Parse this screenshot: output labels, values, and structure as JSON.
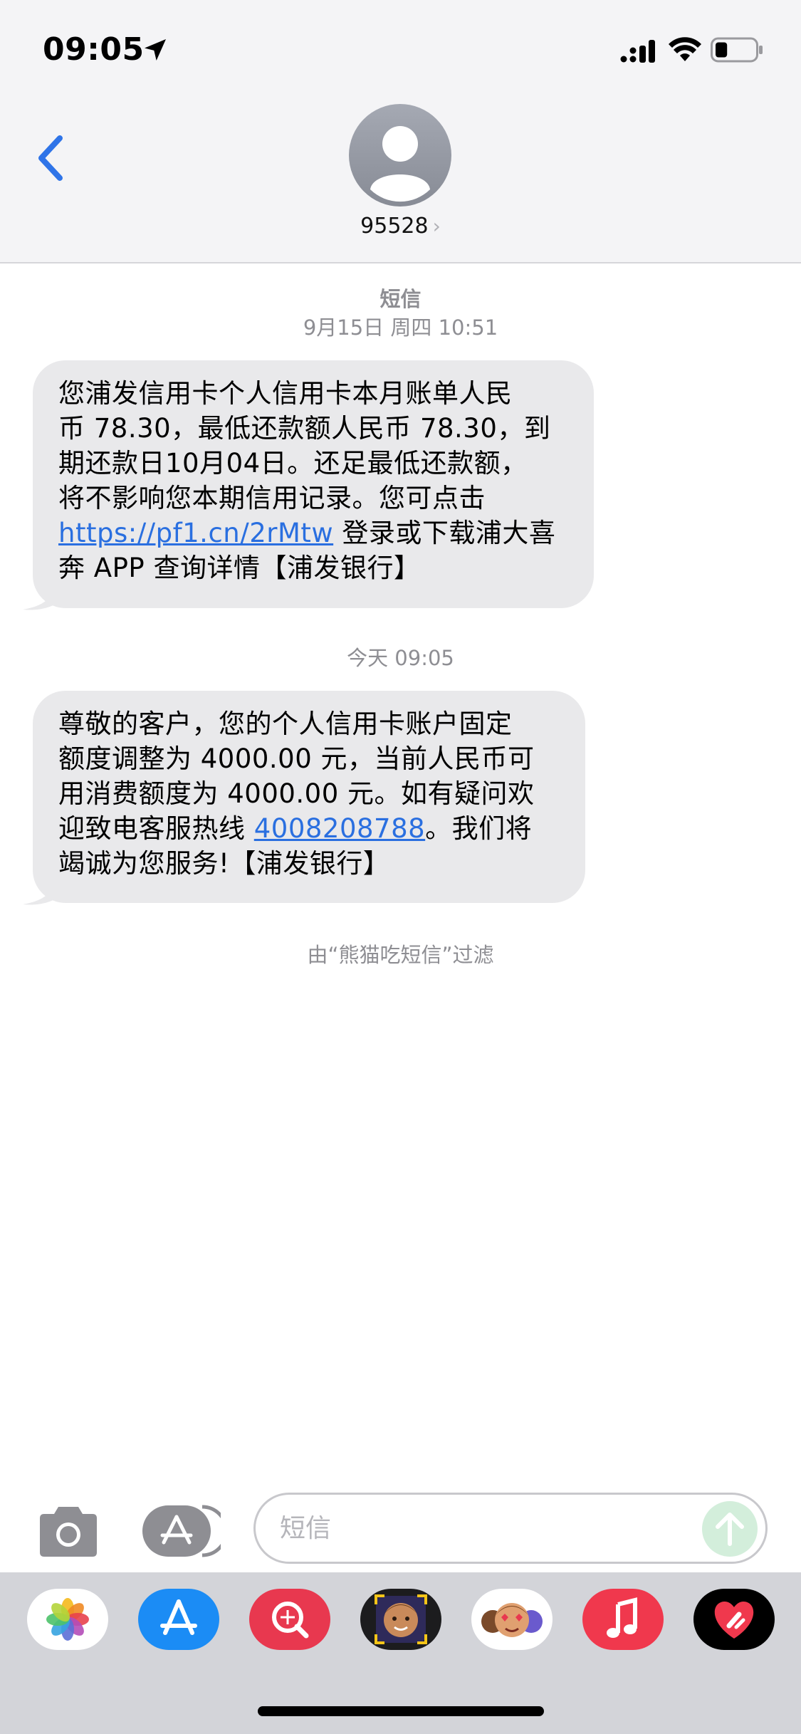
{
  "status_bar": {
    "time": "09:05",
    "battery_level": 0.3
  },
  "header": {
    "contact": "95528",
    "chevron": "›"
  },
  "conversation": {
    "first_meta": {
      "service": "短信",
      "timestamp": "9月15日 周四 10:51"
    },
    "message1": {
      "line1": "您浦发信用卡个人信用卡本月账单人民",
      "line2": "币 78.30，最低还款额人民币 78.30，到",
      "line3": "期还款日10月04日。还足最低还款额，",
      "line4": "将不影响您本期信用记录。您可点击",
      "link": "https://pf1.cn/2rMtw",
      "line5_rest": " 登录或下载浦大喜",
      "line6": "奔 APP 查询详情【浦发银行】"
    },
    "second_meta": {
      "timestamp": "今天 09:05"
    },
    "message2": {
      "line1": "尊敬的客户，您的个人信用卡账户固定",
      "line2": "额度调整为 4000.00 元，当前人民币可",
      "line3": "用消费额度为 4000.00 元。如有疑问欢",
      "line4_start": "迎致电客服热线 ",
      "phone": "4008208788",
      "line4_end": "。我们将",
      "line5": "竭诚为您服务!【浦发银行】"
    },
    "filter_note": "由“熊猫吃短信”过滤"
  },
  "composer": {
    "placeholder": "短信"
  },
  "app_drawer": [
    {
      "name": "photos",
      "bg": "#ffffff"
    },
    {
      "name": "app-store",
      "bg": "#1b8cf5"
    },
    {
      "name": "search-images",
      "bg": "#e8384f"
    },
    {
      "name": "memoji",
      "bg": "#1c1c1e"
    },
    {
      "name": "memoji-stickers",
      "bg": "#ffffff"
    },
    {
      "name": "music",
      "bg": "#f0384d"
    },
    {
      "name": "digital-touch",
      "bg": "#000000"
    }
  ],
  "colors": {
    "accent": "#2a6fe0",
    "bubble": "#e9e9eb",
    "send_disabled": "#d3eedb"
  }
}
